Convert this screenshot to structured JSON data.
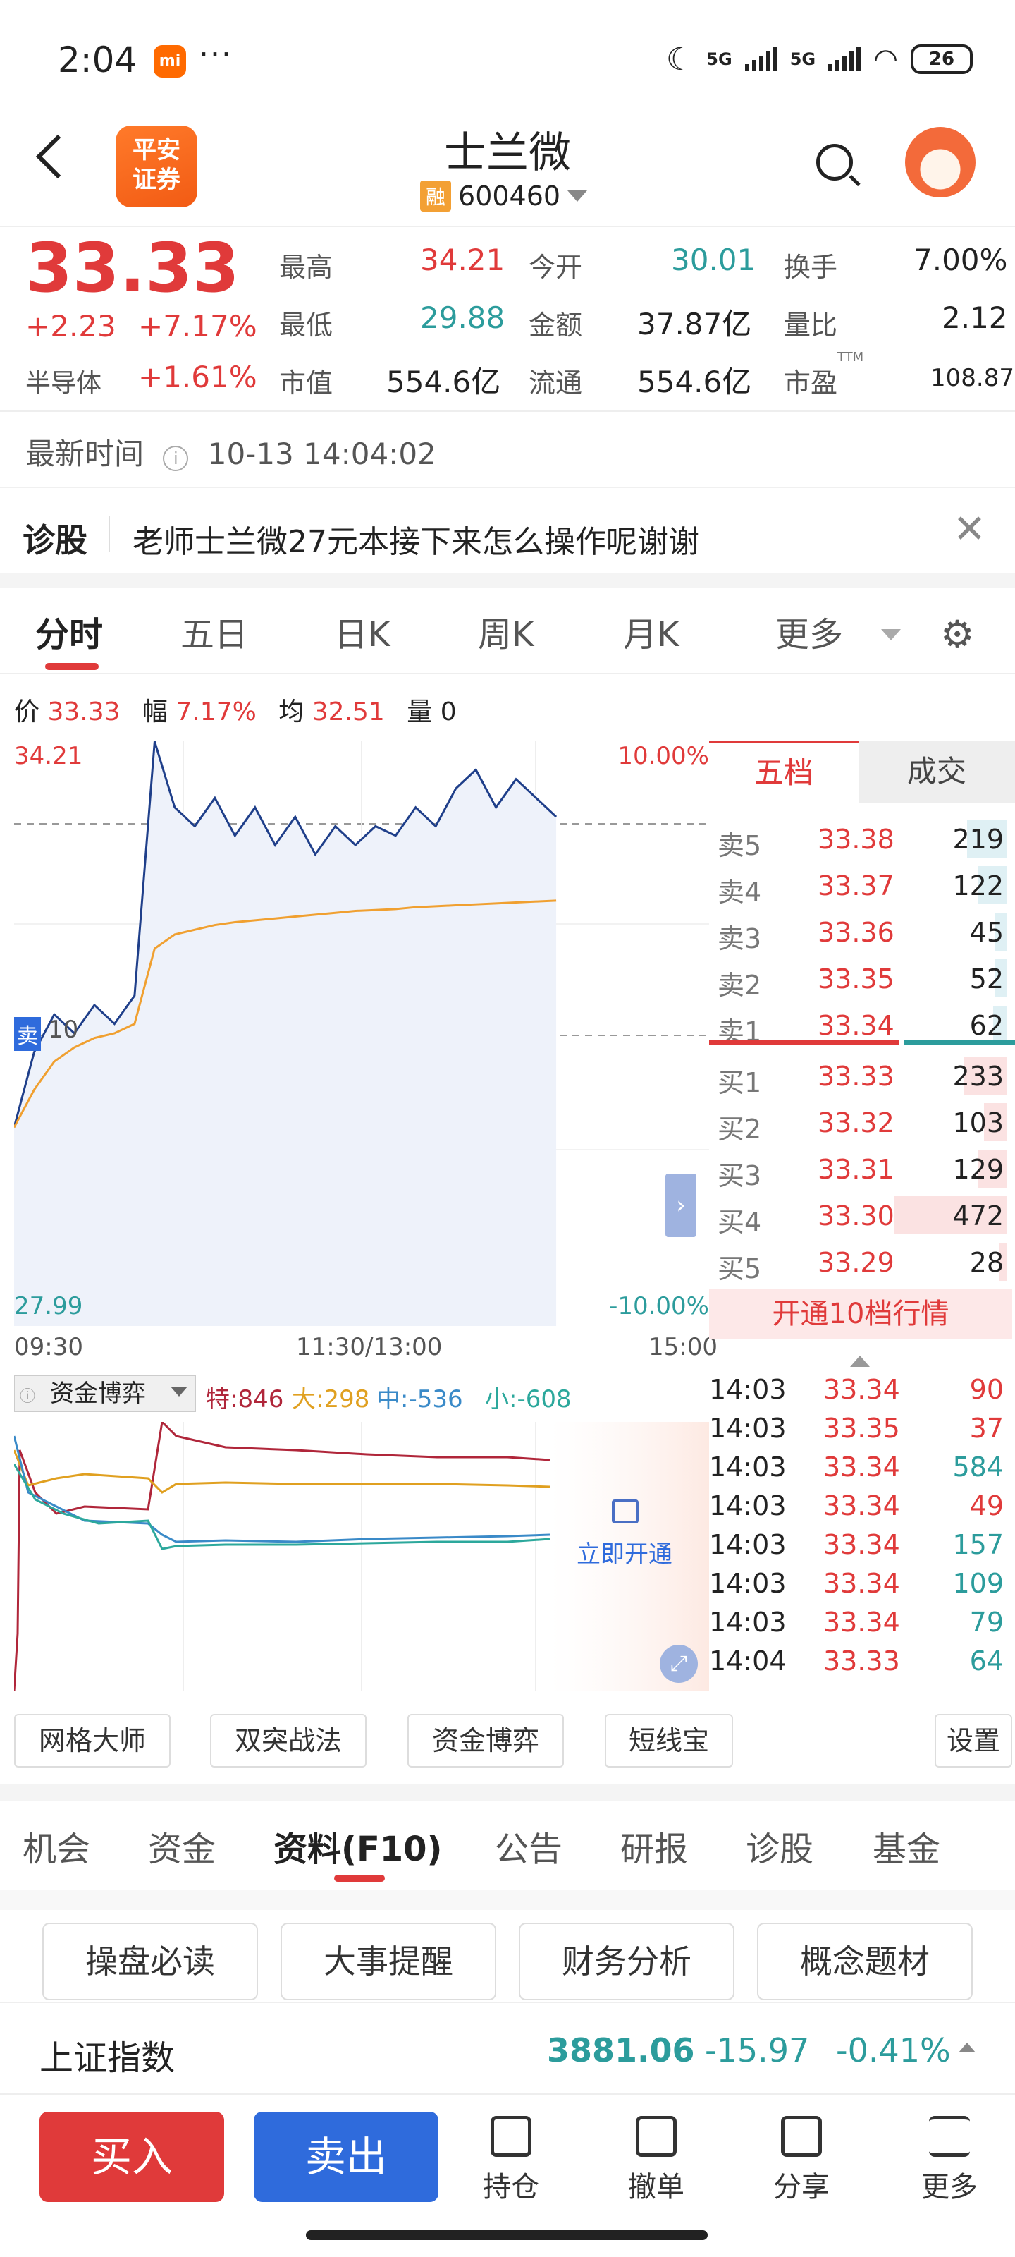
{
  "status_bar": {
    "time": "2:04",
    "mi": "mi",
    "dots": "···",
    "net1": "5G",
    "net2": "5G",
    "battery": "26"
  },
  "header": {
    "stock_name": "士兰微",
    "rong": "融",
    "code": "600460",
    "logo_line1": "平安",
    "logo_line2": "证券"
  },
  "quote": {
    "price": "33.33",
    "change": "+2.23",
    "change_pct": "+7.17%",
    "sector": "半导体",
    "sector_pct": "+1.61%",
    "high_label": "最高",
    "high": "34.21",
    "open_label": "今开",
    "open": "30.01",
    "turnover_label": "换手",
    "turnover": "7.00%",
    "low_label": "最低",
    "low": "29.88",
    "amount_label": "金额",
    "amount": "37.87亿",
    "vol_ratio_label": "量比",
    "vol_ratio": "2.12",
    "mcap_label": "市值",
    "mcap": "554.6亿",
    "float_label": "流通",
    "float": "554.6亿",
    "pe_label": "市盈",
    "pe_sup": "TTM",
    "pe": "108.87"
  },
  "latest_time": {
    "label": "最新时间",
    "value": "10-13 14:04:02"
  },
  "diagnose": {
    "label": "诊股",
    "text": "老师士兰微27元本接下来怎么操作呢谢谢"
  },
  "tabs": [
    "分时",
    "五日",
    "日K",
    "周K",
    "月K",
    "更多"
  ],
  "info_row": {
    "price_label": "价",
    "price": "33.33",
    "amp_label": "幅",
    "amp": "7.17%",
    "avg_label": "均",
    "avg": "32.51",
    "vol_label": "量",
    "vol": "0"
  },
  "chart": {
    "y_top": "34.21",
    "y_bottom": "27.99",
    "pct_top": "10.00%",
    "pct_bottom": "-10.00%",
    "sell_tag": "卖",
    "sell_tag_num": "10",
    "x_start": "09:30",
    "x_mid": "11:30/13:00",
    "x_end": "15:00"
  },
  "chart_data": {
    "type": "line",
    "series": [
      {
        "values": [
          30.1,
          30.9,
          31.3,
          31.1,
          31.4,
          31.2,
          31.5,
          34.2,
          33.5,
          33.3,
          33.6,
          33.2,
          33.5,
          33.1,
          33.4,
          33.0,
          33.3,
          33.1,
          33.3,
          33.2,
          33.5,
          33.3,
          33.7,
          33.9,
          33.5,
          33.8,
          33.6,
          33.4
        ]
      },
      {
        "values": [
          30.1,
          30.5,
          30.8,
          30.95,
          31.05,
          31.1,
          31.2,
          32.0,
          32.15,
          32.2,
          32.25,
          32.28,
          32.3,
          32.32,
          32.34,
          32.36,
          32.38,
          32.4,
          32.41,
          32.42,
          32.44,
          32.45,
          32.46,
          32.47,
          32.48,
          32.49,
          32.5,
          32.51
        ]
      }
    ],
    "x": [
      "09:30",
      "11:30/13:00",
      "15:00"
    ],
    "ylim": [
      27.99,
      34.21
    ]
  },
  "orderbook": {
    "tab_active": "五档",
    "tab_other": "成交",
    "asks": [
      {
        "label": "卖5",
        "price": "33.38",
        "vol": "219",
        "fill": 0.35
      },
      {
        "label": "卖4",
        "price": "33.37",
        "vol": "122",
        "fill": 0.25
      },
      {
        "label": "卖3",
        "price": "33.36",
        "vol": "45",
        "fill": 0.1
      },
      {
        "label": "卖2",
        "price": "33.35",
        "vol": "52",
        "fill": 0.1
      },
      {
        "label": "卖1",
        "price": "33.34",
        "vol": "62",
        "fill": 0.12
      }
    ],
    "bids": [
      {
        "label": "买1",
        "price": "33.33",
        "vol": "233",
        "fill": 0.38
      },
      {
        "label": "买2",
        "price": "33.32",
        "vol": "103",
        "fill": 0.2
      },
      {
        "label": "买3",
        "price": "33.31",
        "vol": "129",
        "fill": 0.25
      },
      {
        "label": "买4",
        "price": "33.30",
        "vol": "472",
        "fill": 1.0
      },
      {
        "label": "买5",
        "price": "33.29",
        "vol": "28",
        "fill": 0.06
      }
    ],
    "upgrade": "开通10档行情"
  },
  "ticks": [
    {
      "time": "14:03",
      "price": "33.34",
      "vol": "90",
      "color": "red"
    },
    {
      "time": "14:03",
      "price": "33.35",
      "vol": "37",
      "color": "red"
    },
    {
      "time": "14:03",
      "price": "33.34",
      "vol": "584",
      "color": "green"
    },
    {
      "time": "14:03",
      "price": "33.34",
      "vol": "49",
      "color": "red"
    },
    {
      "time": "14:03",
      "price": "33.34",
      "vol": "157",
      "color": "green"
    },
    {
      "time": "14:03",
      "price": "33.34",
      "vol": "109",
      "color": "green"
    },
    {
      "time": "14:03",
      "price": "33.34",
      "vol": "79",
      "color": "green"
    },
    {
      "time": "14:04",
      "price": "33.33",
      "vol": "64",
      "color": "green"
    }
  ],
  "fund_game": {
    "label": "资金博弈",
    "te": "特:846",
    "da": "大:298",
    "zhong": "中:-536",
    "xiao": "小:-608",
    "unlock": "立即开通"
  },
  "tools": [
    "网格大师",
    "双突战法",
    "资金博弈",
    "短线宝",
    "设置"
  ],
  "f10_tabs": [
    "机会",
    "资金",
    "资料(F10)",
    "公告",
    "研报",
    "诊股",
    "基金"
  ],
  "f10_buttons": [
    "操盘必读",
    "大事提醒",
    "财务分析",
    "概念题材"
  ],
  "index_bar": {
    "name": "上证指数",
    "value": "3881.06",
    "change": "-15.97",
    "pct": "-0.41%"
  },
  "bottom_nav": {
    "buy": "买入",
    "sell": "卖出",
    "items": [
      "持仓",
      "撤单",
      "分享",
      "更多"
    ]
  },
  "colors": {
    "red": "#e03a3a",
    "green": "#2c9c9c",
    "blue": "#2f6bdc",
    "orange": "#f08a2a"
  }
}
